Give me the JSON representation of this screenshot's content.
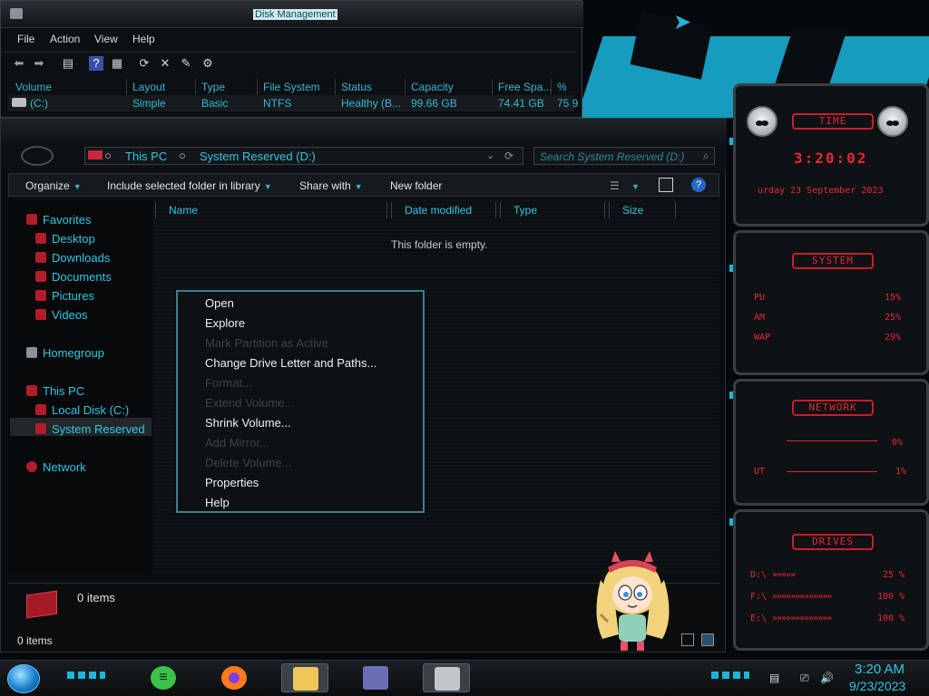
{
  "disk_management": {
    "title": "Disk Management",
    "menu": [
      "File",
      "Action",
      "View",
      "Help"
    ],
    "columns": [
      "Volume",
      "Layout",
      "Type",
      "File System",
      "Status",
      "Capacity",
      "Free Spa...",
      "% F"
    ],
    "row": {
      "volume": "(C:)",
      "layout": "Simple",
      "type": "Basic",
      "file_system": "NTFS",
      "status": "Healthy (B...",
      "capacity": "99.66 GB",
      "free_space": "74.41 GB",
      "percent_free": "75 9"
    }
  },
  "explorer": {
    "breadcrumb": [
      "This PC",
      "System Reserved (D:)"
    ],
    "search_placeholder": "Search System Reserved (D:)",
    "commands": [
      "Organize",
      "Include selected folder in library",
      "Share with",
      "New folder"
    ],
    "nav": {
      "favorites": "Favorites",
      "desktop": "Desktop",
      "downloads": "Downloads",
      "documents": "Documents",
      "pictures": "Pictures",
      "videos": "Videos",
      "homegroup": "Homegroup",
      "this_pc": "This PC",
      "local_disk": "Local Disk (C:)",
      "system_reserved": "System Reserved",
      "network": "Network"
    },
    "columns": [
      "Name",
      "Date modified",
      "Type",
      "Size"
    ],
    "empty_message": "This folder is empty.",
    "details_count": "0 items",
    "status_count": "0 items"
  },
  "context_menu": {
    "items": [
      {
        "label": "Open",
        "enabled": true
      },
      {
        "label": "Explore",
        "enabled": true
      },
      {
        "label": "Mark Partition as Active",
        "enabled": false
      },
      {
        "label": "Change Drive Letter and Paths...",
        "enabled": true
      },
      {
        "label": "Format...",
        "enabled": false
      },
      {
        "label": "Extend Volume...",
        "enabled": false
      },
      {
        "label": "Shrink Volume...",
        "enabled": true
      },
      {
        "label": "Add Mirror...",
        "enabled": false
      },
      {
        "label": "Delete Volume...",
        "enabled": false
      },
      {
        "label": "Properties",
        "enabled": true
      },
      {
        "label": "Help",
        "enabled": true
      }
    ]
  },
  "rainmeter": {
    "time_badge": "TIME",
    "time": "3:20:02",
    "date": "urday 23 September 2023",
    "system_badge": "SYSTEM",
    "system_rows": [
      {
        "label": "PU",
        "value": "15%"
      },
      {
        "label": "AM",
        "value": "25%"
      },
      {
        "label": "WAP",
        "value": "29%"
      }
    ],
    "network_badge": "NETWORK",
    "network_rows": [
      {
        "label": "",
        "value": "0%"
      },
      {
        "label": "UT",
        "value": "1%"
      }
    ],
    "drives_badge": "DRIVES",
    "drives_rows": [
      {
        "label": "D:\\",
        "value": "25 %"
      },
      {
        "label": "F:\\",
        "value": "100 %"
      },
      {
        "label": "E:\\",
        "value": "100 %"
      }
    ]
  },
  "taskbar": {
    "clock_time": "3:20 AM",
    "clock_date": "9/23/2023"
  },
  "colors": {
    "accent_cyan": "#2ec8e4",
    "accent_red": "#e6263a",
    "background": "#0b0e10"
  }
}
